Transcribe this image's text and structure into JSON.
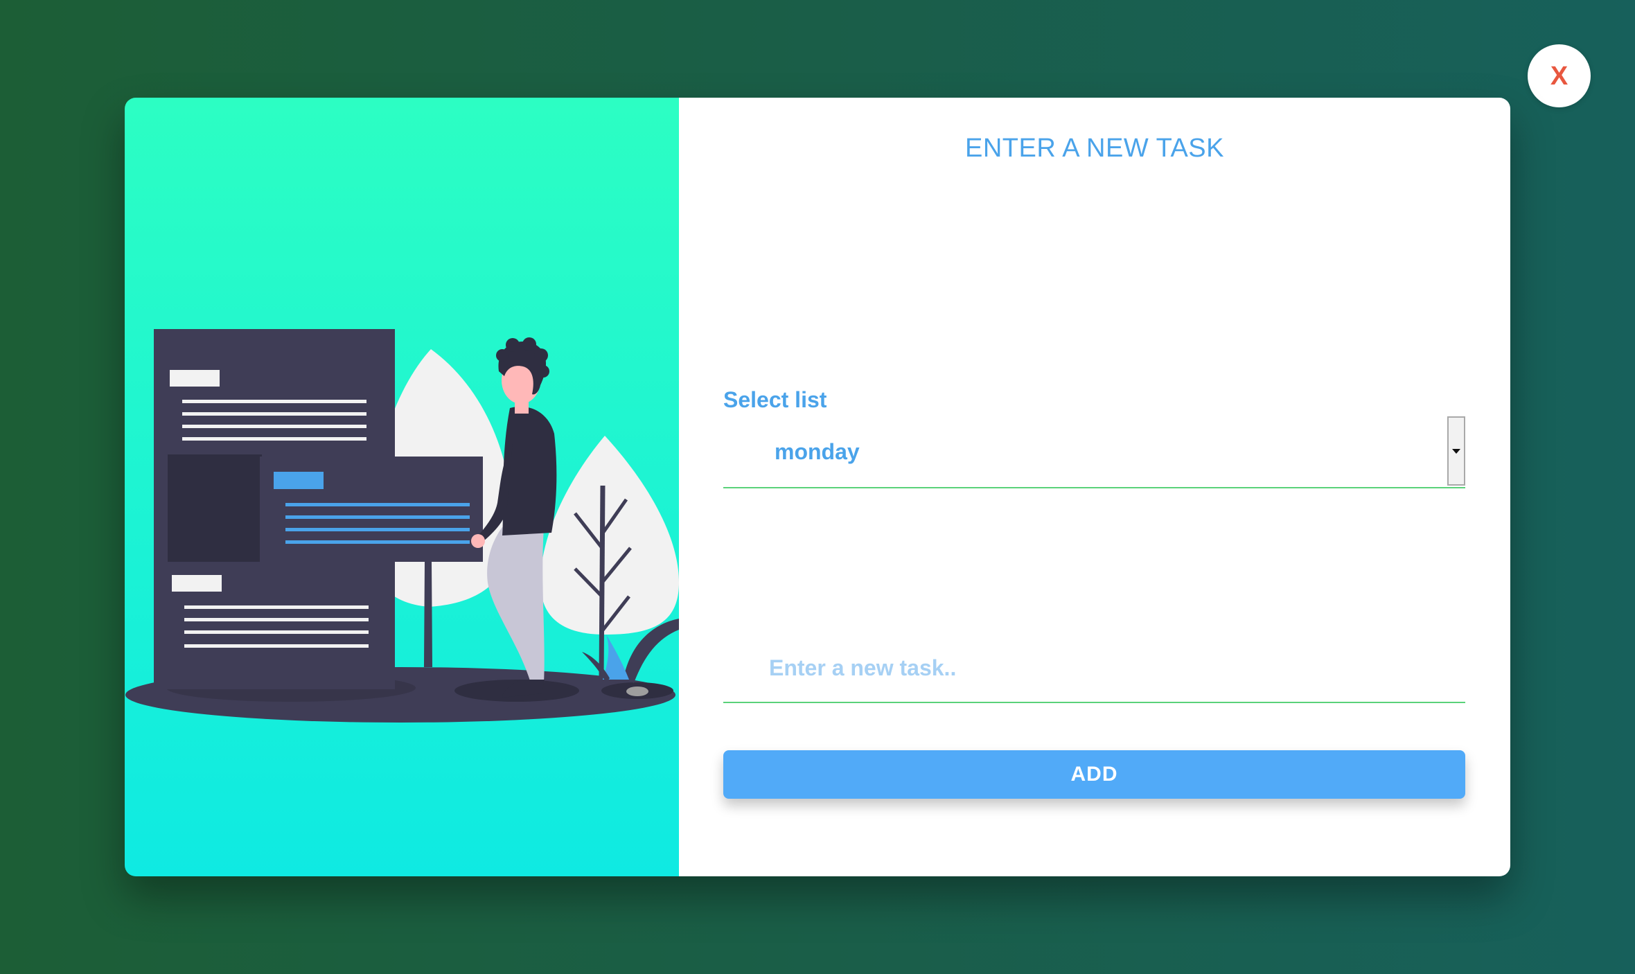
{
  "close_button": {
    "label": "X"
  },
  "form": {
    "title": "ENTER A NEW TASK",
    "select_label": "Select list",
    "selected_list": "monday",
    "task_placeholder": "Enter a new task..",
    "task_value": "",
    "add_label": "ADD"
  },
  "colors": {
    "background_left": "#1c5e36",
    "background_right": "#17605b",
    "panel_gradient_top": "#2cfec3",
    "panel_gradient_bottom": "#0feae2",
    "accent": "#4aa3ea",
    "button": "#51aaf8",
    "underline": "#5ad27a",
    "close_x": "#e8573f"
  },
  "illustration": {
    "name": "person-with-task-documents"
  }
}
